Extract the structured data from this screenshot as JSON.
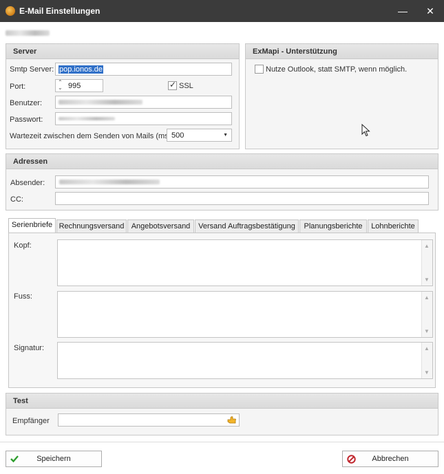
{
  "window": {
    "title": "E-Mail Einstellungen",
    "minimize": "—",
    "close": "✕"
  },
  "server": {
    "title": "Server",
    "smtp_label": "Smtp Server:",
    "smtp_value": "pop.ionos.de",
    "port_label": "Port:",
    "port_value": "995",
    "ssl_label": "SSL",
    "ssl_checked": true,
    "user_label": "Benutzer:",
    "password_label": "Passwort:",
    "wait_label": "Wartezeit zwischen dem Senden von Mails (ms):",
    "wait_value": "500"
  },
  "exmapi": {
    "title": "ExMapi - Unterstützung",
    "option_label": "Nutze Outlook, statt SMTP, wenn möglich."
  },
  "addresses": {
    "title": "Adressen",
    "sender_label": "Absender:",
    "cc_label": "CC:"
  },
  "tabs": [
    "Serienbriefe",
    "Rechnungsversand",
    "Angebotsversand",
    "Versand Auftragsbestätigung",
    "Planungsberichte",
    "Lohnberichte"
  ],
  "tab_content": {
    "header_label": "Kopf:",
    "footer_label": "Fuss:",
    "signature_label": "Signatur:"
  },
  "test": {
    "title": "Test",
    "recipient_label": "Empfänger"
  },
  "buttons": {
    "save": "Speichern",
    "cancel": "Abbrechen"
  },
  "colors": {
    "titlebar": "#3b3b3b",
    "selection": "#3070c8",
    "save_check": "#2e9e2e",
    "cancel_icon": "#c0262d"
  },
  "icons": [
    "app-icon",
    "minimize-icon",
    "close-icon",
    "spin-icon",
    "dropdown-arrow-icon",
    "send-hand-icon",
    "checkmark-icon",
    "cancel-icon",
    "mouse-cursor-icon"
  ]
}
